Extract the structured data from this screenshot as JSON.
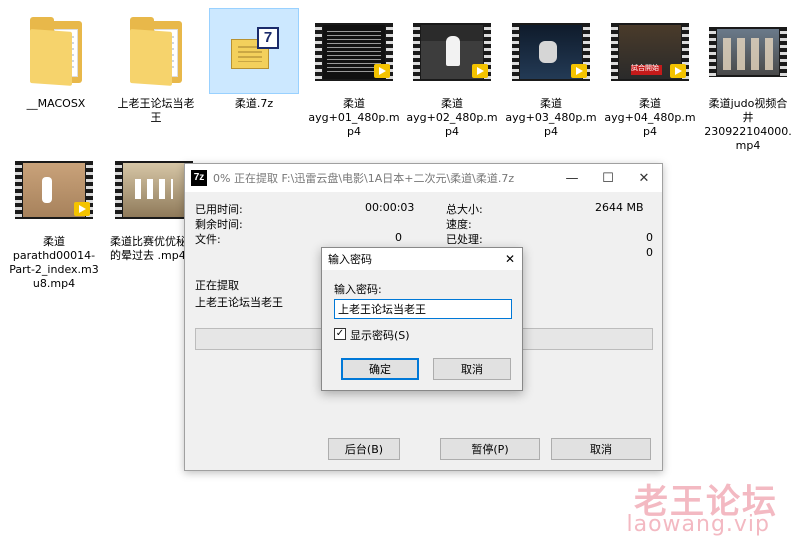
{
  "files": [
    {
      "name": "__MACOSX",
      "type": "folder"
    },
    {
      "name": "上老王论坛当老王",
      "type": "folder"
    },
    {
      "name": "柔道.7z",
      "type": "archive",
      "selected": true
    },
    {
      "name": "柔道ayg+01_480p.mp4",
      "type": "video",
      "badge": "Player"
    },
    {
      "name": "柔道ayg+02_480p.mp4",
      "type": "video",
      "badge": "Player"
    },
    {
      "name": "柔道ayg+03_480p.mp4",
      "type": "video",
      "badge": "Player"
    },
    {
      "name": "柔道ayg+04_480p.mp4",
      "type": "video",
      "badge": "Player",
      "frame_caption": "試合開始"
    },
    {
      "name": "柔道judo视频合井230922104000.mp4",
      "type": "video"
    },
    {
      "name": "柔道parathd00014-Part-2_index.m3u8.mp4",
      "type": "video",
      "badge": "Player"
    },
    {
      "name": "柔道比赛优优秘的晕过去 .mp4",
      "type": "video"
    }
  ],
  "file_labels": {
    "f0": "__MACOSX",
    "f1": "上老王论坛当老\n王",
    "f2": "柔道.7z",
    "f3": "柔道\nayg+01_480p.m\np4",
    "f4": "柔道\nayg+02_480p.m\np4",
    "f5": "柔道\nayg+03_480p.m\np4",
    "f6": "柔道\nayg+04_480p.m\np4",
    "f7": "柔道judo视频合\n井\n230922104000.\nmp4",
    "f8": "柔道\nparathd00014-\nPart-2_index.m3\nu8.mp4",
    "f9": "柔道比赛优优秘\n的晕过去 .mp4"
  },
  "zip_window": {
    "app_icon": "7z",
    "title": "0% 正在提取 F:\\迅雷云盘\\电影\\1A日本+二次元\\柔道\\柔道.7z",
    "elapsed_label": "已用时间:",
    "elapsed_value": "00:00:03",
    "remaining_label": "剩余时间:",
    "files_label": "文件:",
    "files_value": "0",
    "total_size_label": "总大小:",
    "total_size_value": "2644 MB",
    "speed_label": "速度:",
    "processed_label": "已处理:",
    "processed_value": "0",
    "extra_value": "0",
    "extracting_label": "正在提取",
    "current_item": "上老王论坛当老王",
    "progress_percent": 0,
    "background_button": "后台(B)",
    "pause_button": "暂停(P)",
    "cancel_button": "取消",
    "minimize_glyph": "—",
    "maximize_glyph": "☐",
    "close_glyph": "✕"
  },
  "password_dialog": {
    "title": "输入密码",
    "close_glyph": "✕",
    "prompt_label": "输入密码:",
    "password_value": "上老王论坛当老王",
    "show_password_label": "显示密码(S)",
    "show_password_checked": true,
    "ok_button": "确定",
    "cancel_button": "取消"
  },
  "watermark": {
    "line1": "老王论坛",
    "line2": "laowang.vip"
  },
  "colors": {
    "accent": "#0078d7",
    "selection": "#cce8ff",
    "watermark": "#f3b9c2"
  }
}
